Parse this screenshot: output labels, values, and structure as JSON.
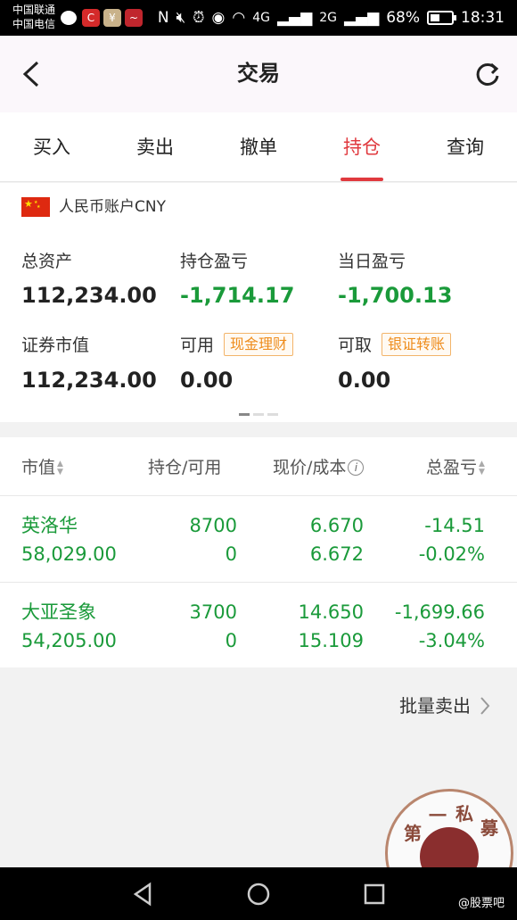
{
  "status_bar": {
    "carrier1": "中国联通",
    "carrier2": "中国电信",
    "network_4g": "4G",
    "network_2g": "2G",
    "battery": "68%",
    "time": "18:31",
    "icons": [
      "message-icon",
      "c-app-icon",
      "wallet-app-icon",
      "stock-app-icon",
      "nfc-icon",
      "mute-icon",
      "alarm-icon",
      "eye-icon",
      "wifi-icon",
      "signal-icon",
      "battery-icon"
    ]
  },
  "header": {
    "title": "交易",
    "back_icon": "chevron-left-icon",
    "refresh_icon": "refresh-icon"
  },
  "tabs": [
    {
      "label": "买入"
    },
    {
      "label": "卖出"
    },
    {
      "label": "撤单"
    },
    {
      "label": "持仓",
      "active": true
    },
    {
      "label": "查询"
    }
  ],
  "account": {
    "name": "人民币账户CNY",
    "total_assets_label": "总资产",
    "total_assets": "112,234.00",
    "position_pl_label": "持仓盈亏",
    "position_pl": "-1,714.17",
    "daily_pl_label": "当日盈亏",
    "daily_pl": "-1,700.13",
    "market_value_label": "证券市值",
    "market_value": "112,234.00",
    "available_label": "可用",
    "available": "0.00",
    "cash_mgmt_label": "现金理财",
    "withdrawable_label": "可取",
    "withdrawable": "0.00",
    "bank_transfer_label": "银证转账"
  },
  "table": {
    "headers": [
      "市值",
      "持仓/可用",
      "现价/成本",
      "总盈亏"
    ],
    "rows": [
      {
        "name": "英洛华",
        "market_value": "58,029.00",
        "position": "8700",
        "available": "0",
        "price": "6.670",
        "cost": "6.672",
        "pl": "-14.51",
        "pl_pct": "-0.02%"
      },
      {
        "name": "大亚圣象",
        "market_value": "54,205.00",
        "position": "3700",
        "available": "0",
        "price": "14.650",
        "cost": "15.109",
        "pl": "-1,699.66",
        "pl_pct": "-3.04%"
      }
    ]
  },
  "bulk_sell_label": "批量卖出",
  "watermark": {
    "chars": [
      "第",
      "一",
      "私",
      "募"
    ],
    "caption": "@股票吧"
  },
  "colors": {
    "accent_red": "#e0393e",
    "loss_green": "#1a9a3a",
    "tag_orange": "#ee8c1c"
  }
}
